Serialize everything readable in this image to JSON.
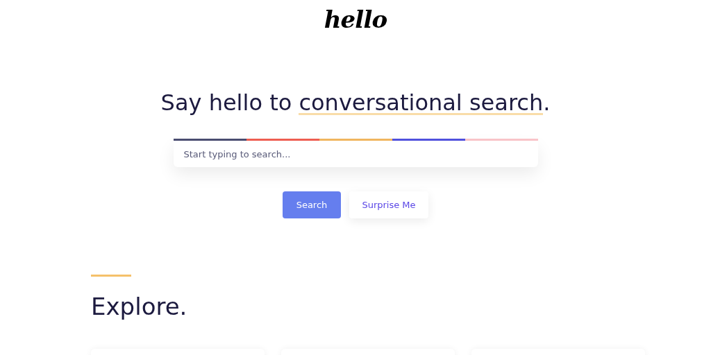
{
  "logo": "hello",
  "heading": {
    "before": "Say hello to ",
    "highlight": "conversational search",
    "after": "."
  },
  "search": {
    "stripe": [
      {
        "color": "#4b4e72"
      },
      {
        "color": "#f15f52"
      },
      {
        "color": "#f3b860"
      },
      {
        "color": "#5152e0"
      },
      {
        "color": "#fbc6cb"
      }
    ],
    "placeholder": "Start typing to search..."
  },
  "buttons": [
    {
      "label": "Search",
      "kind": "primary"
    },
    {
      "label": "Surprise Me",
      "kind": "secondary"
    }
  ],
  "explore": {
    "title": "Explore."
  }
}
